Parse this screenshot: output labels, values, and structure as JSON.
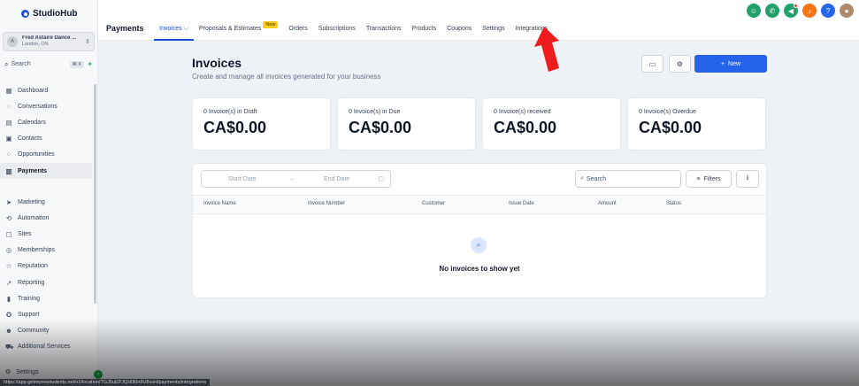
{
  "app": {
    "name": "StudioHub"
  },
  "account": {
    "initials": "A",
    "name": "Fred Astaire Dance ...",
    "location": "London, ON"
  },
  "sidebar": {
    "search_label": "Search",
    "search_shortcut": "⌘ K",
    "items": [
      {
        "icon": "dashboard-icon",
        "label": "Dashboard"
      },
      {
        "icon": "chat-icon",
        "label": "Conversations"
      },
      {
        "icon": "calendar-icon",
        "label": "Calendars"
      },
      {
        "icon": "contacts-icon",
        "label": "Contacts"
      },
      {
        "icon": "opportunities-icon",
        "label": "Opportunities"
      },
      {
        "icon": "payments-icon",
        "label": "Payments"
      }
    ],
    "items2": [
      {
        "icon": "marketing-icon",
        "label": "Marketing"
      },
      {
        "icon": "automation-icon",
        "label": "Automation"
      },
      {
        "icon": "sites-icon",
        "label": "Sites"
      },
      {
        "icon": "memberships-icon",
        "label": "Memberships"
      },
      {
        "icon": "reputation-icon",
        "label": "Reputation"
      },
      {
        "icon": "reporting-icon",
        "label": "Reporting"
      },
      {
        "icon": "training-icon",
        "label": "Training"
      },
      {
        "icon": "support-icon",
        "label": "Support"
      },
      {
        "icon": "community-icon",
        "label": "Community"
      },
      {
        "icon": "cart-icon",
        "label": "Additional Services"
      }
    ],
    "settings_label": "Settings"
  },
  "topbar": {
    "title": "Payments",
    "tabs": [
      {
        "label": "Invoices ⌵",
        "active": true
      },
      {
        "label": "Proposals & Estimates",
        "badge": "New"
      },
      {
        "label": "Orders"
      },
      {
        "label": "Subscriptions"
      },
      {
        "label": "Transactions"
      },
      {
        "label": "Products"
      },
      {
        "label": "Coupons"
      },
      {
        "label": "Settings"
      },
      {
        "label": "Integrations"
      }
    ],
    "icons": [
      "support-agent-icon",
      "phone-icon",
      "megaphone-icon",
      "bell-icon",
      "help-icon",
      "user-avatar"
    ],
    "colors": {
      "green": "#22a06b",
      "orange": "#f97316",
      "blue": "#2563eb",
      "accent": "#1d4ed8"
    }
  },
  "main": {
    "title": "Invoices",
    "subtitle": "Create and manage all invoices generated for your business",
    "new_button": "New",
    "stats": [
      {
        "label": "0 Invoice(s) in Draft",
        "value": "CA$0.00"
      },
      {
        "label": "0 Invoice(s) in Due",
        "value": "CA$0.00"
      },
      {
        "label": "0 Invoice(s) received",
        "value": "CA$0.00"
      },
      {
        "label": "0 Invoice(s) Overdue",
        "value": "CA$0.00"
      }
    ],
    "filters": {
      "start_date": "Start Date",
      "end_date": "End Date",
      "search_placeholder": "Search",
      "filters_label": "Filters"
    },
    "columns": [
      "Invoice Name",
      "Invoice Number",
      "Customer",
      "Issue Date",
      "Amount",
      "Status"
    ],
    "empty_text": "No invoices to show yet"
  },
  "status_url": "https://app.getmoresstudents.net/v2/location/TGJ5uEPJQHlIl0n8U8ssH/payments/integrations"
}
